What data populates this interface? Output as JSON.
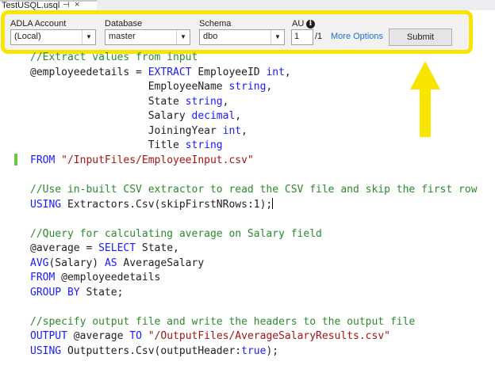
{
  "tab": {
    "title": "TestUSQL.usql",
    "pin_icon": "⊣",
    "close_icon": "×"
  },
  "toolbar": {
    "account_label": "ADLA Account",
    "account_value": "(Local)",
    "database_label": "Database",
    "database_value": "master",
    "schema_label": "Schema",
    "schema_value": "dbo",
    "au_label": "AU",
    "au_value": "1",
    "au_max": "/1",
    "more_options": "More Options",
    "submit": "Submit"
  },
  "code_lines": [
    {
      "parts": [
        {
          "c": "c",
          "t": "//Extract values from input"
        }
      ]
    },
    {
      "parts": [
        {
          "c": "t",
          "t": "@employeedetails = "
        },
        {
          "c": "k",
          "t": "EXTRACT"
        },
        {
          "c": "t",
          "t": " EmployeeID "
        },
        {
          "c": "k",
          "t": "int"
        },
        {
          "c": "t",
          "t": ","
        }
      ]
    },
    {
      "parts": [
        {
          "c": "t",
          "t": "                   EmployeeName "
        },
        {
          "c": "k",
          "t": "string"
        },
        {
          "c": "t",
          "t": ","
        }
      ]
    },
    {
      "parts": [
        {
          "c": "t",
          "t": "                   State "
        },
        {
          "c": "k",
          "t": "string"
        },
        {
          "c": "t",
          "t": ","
        }
      ]
    },
    {
      "parts": [
        {
          "c": "t",
          "t": "                   Salary "
        },
        {
          "c": "k",
          "t": "decimal"
        },
        {
          "c": "t",
          "t": ","
        }
      ]
    },
    {
      "parts": [
        {
          "c": "t",
          "t": "                   JoiningYear "
        },
        {
          "c": "k",
          "t": "int"
        },
        {
          "c": "t",
          "t": ","
        }
      ]
    },
    {
      "parts": [
        {
          "c": "t",
          "t": "                   Title "
        },
        {
          "c": "k",
          "t": "string"
        }
      ]
    },
    {
      "parts": [
        {
          "c": "k",
          "t": "FROM"
        },
        {
          "c": "t",
          "t": " "
        },
        {
          "c": "s",
          "t": "\"/InputFiles/EmployeeInput.csv\""
        }
      ]
    },
    {
      "parts": []
    },
    {
      "parts": [
        {
          "c": "c",
          "t": "//Use in-built CSV extractor to read the CSV file and skip the first row"
        }
      ]
    },
    {
      "parts": [
        {
          "c": "k",
          "t": "USING"
        },
        {
          "c": "t",
          "t": " Extractors.Csv(skipFirstNRows:1);"
        }
      ],
      "cursor": true
    },
    {
      "parts": []
    },
    {
      "parts": [
        {
          "c": "c",
          "t": "//Query for calculating average on Salary field"
        }
      ]
    },
    {
      "parts": [
        {
          "c": "t",
          "t": "@average = "
        },
        {
          "c": "k",
          "t": "SELECT"
        },
        {
          "c": "t",
          "t": " State,"
        }
      ]
    },
    {
      "parts": [
        {
          "c": "k",
          "t": "AVG"
        },
        {
          "c": "t",
          "t": "(Salary) "
        },
        {
          "c": "k",
          "t": "AS"
        },
        {
          "c": "t",
          "t": " AverageSalary"
        }
      ]
    },
    {
      "parts": [
        {
          "c": "k",
          "t": "FROM"
        },
        {
          "c": "t",
          "t": " @employeedetails"
        }
      ]
    },
    {
      "parts": [
        {
          "c": "k",
          "t": "GROUP BY"
        },
        {
          "c": "t",
          "t": " State;"
        }
      ]
    },
    {
      "parts": []
    },
    {
      "parts": [
        {
          "c": "c",
          "t": "//specify output file and write the headers to the output file"
        }
      ]
    },
    {
      "parts": [
        {
          "c": "k",
          "t": "OUTPUT"
        },
        {
          "c": "t",
          "t": " @average "
        },
        {
          "c": "k",
          "t": "TO"
        },
        {
          "c": "t",
          "t": " "
        },
        {
          "c": "s",
          "t": "\"/OutputFiles/AverageSalaryResults.csv\""
        }
      ]
    },
    {
      "parts": [
        {
          "c": "k",
          "t": "USING"
        },
        {
          "c": "t",
          "t": " Outputters.Csv(outputHeader:"
        },
        {
          "c": "k",
          "t": "true"
        },
        {
          "c": "t",
          "t": ");"
        }
      ]
    }
  ],
  "colors": {
    "highlight": "#f7e400",
    "comment": "#2b8a2b",
    "keyword": "#1a1aff",
    "string": "#a31515",
    "change_marker": "#6cc644"
  }
}
